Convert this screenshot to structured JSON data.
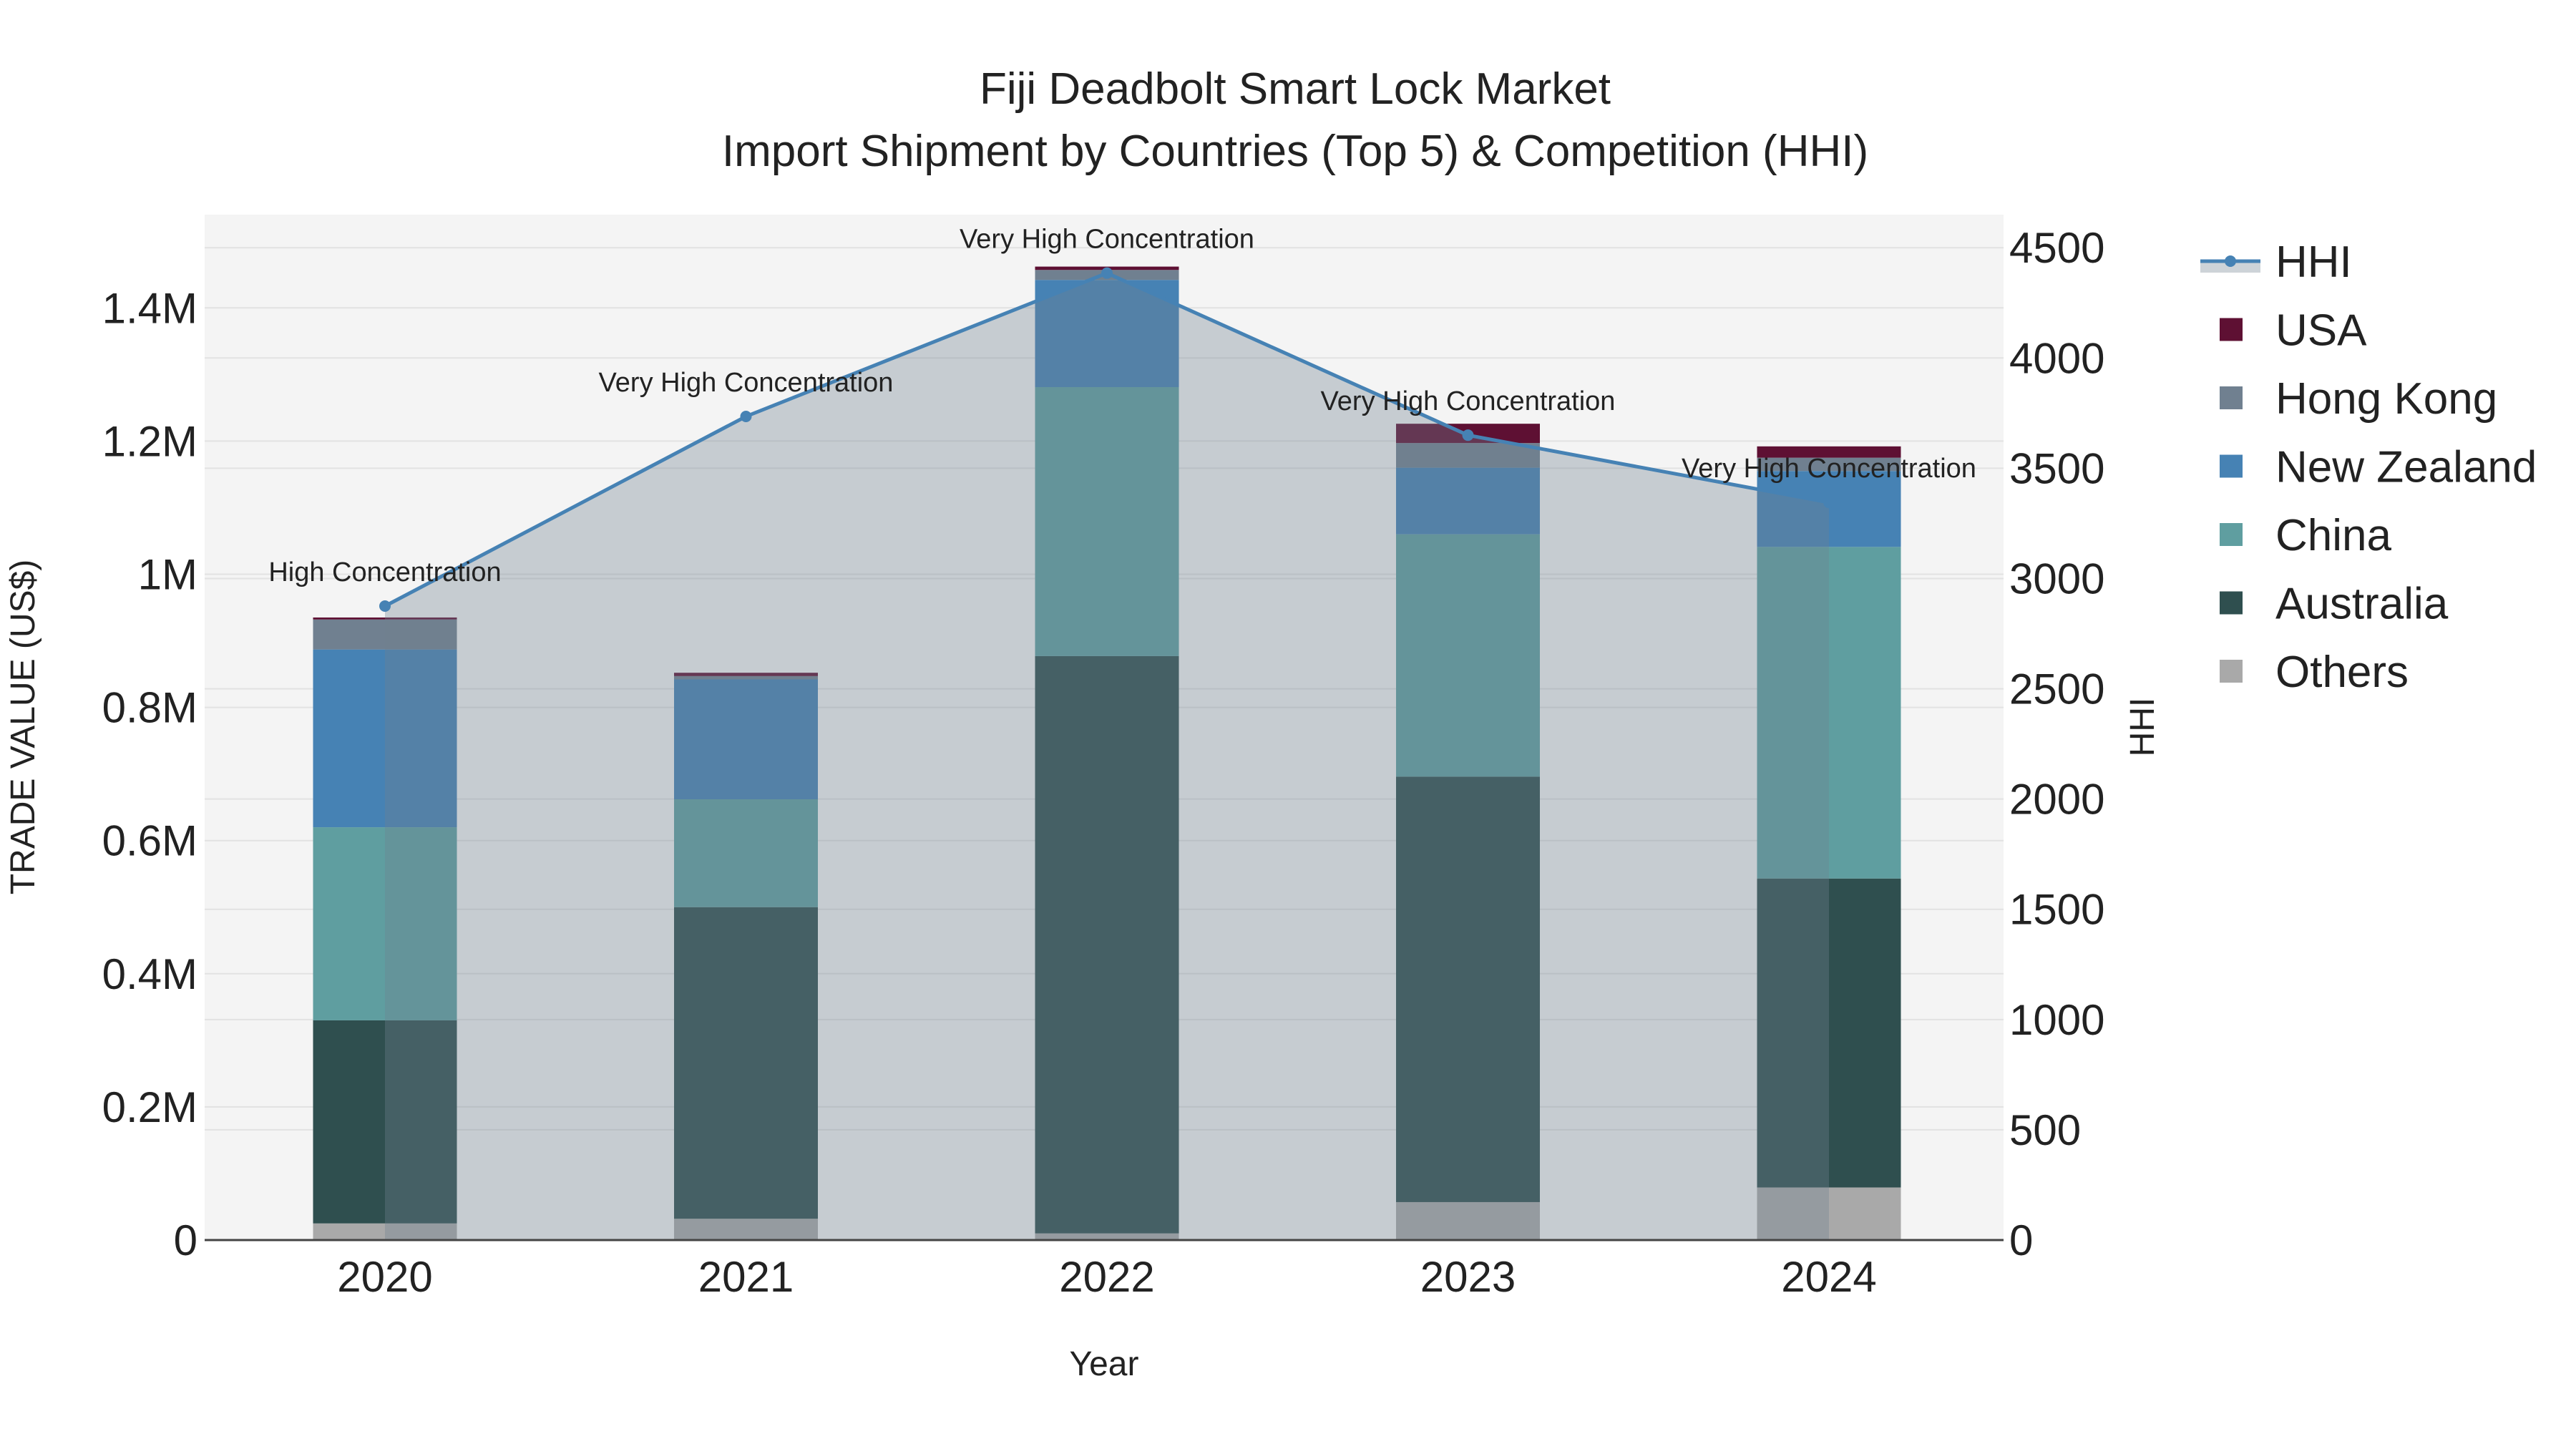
{
  "chart_data": {
    "type": "bar",
    "title": "Fiji Deadbolt Smart Lock Market",
    "subtitle": "Import Shipment by Countries (Top 5) & Competition (HHI)",
    "xlabel": "Year",
    "ylabel": "TRADE VALUE (US$)",
    "y2label": "HHI",
    "categories": [
      "2020",
      "2021",
      "2022",
      "2023",
      "2024"
    ],
    "stacked": true,
    "ylim": [
      0,
      1540000
    ],
    "y2lim": [
      0,
      4650
    ],
    "yticks": [
      0,
      200000,
      400000,
      600000,
      800000,
      1000000,
      1200000,
      1400000
    ],
    "ytick_labels": [
      "0",
      "0.2M",
      "0.4M",
      "0.6M",
      "0.8M",
      "1M",
      "1.2M",
      "1.4M"
    ],
    "y2ticks": [
      0,
      500,
      1000,
      1500,
      2000,
      2500,
      3000,
      3500,
      4000,
      4500
    ],
    "y2tick_labels": [
      "0",
      "500",
      "1000",
      "1500",
      "2000",
      "2500",
      "3000",
      "3500",
      "4000",
      "4500"
    ],
    "series": [
      {
        "name": "Others",
        "color": "#a9a9a9",
        "values": [
          25000,
          32000,
          10000,
          57000,
          79000
        ]
      },
      {
        "name": "Australia",
        "color": "#2f4f4f",
        "values": [
          305000,
          468000,
          867000,
          639000,
          464000
        ]
      },
      {
        "name": "China",
        "color": "#5f9ea0",
        "values": [
          290000,
          162000,
          404000,
          364000,
          498000
        ]
      },
      {
        "name": "New Zealand",
        "color": "#4682b4",
        "values": [
          267000,
          180000,
          161000,
          100000,
          114000
        ]
      },
      {
        "name": "Hong Kong",
        "color": "#708090",
        "values": [
          45000,
          5000,
          15000,
          37000,
          20000
        ]
      },
      {
        "name": "USA",
        "color": "#5e1033",
        "values": [
          3000,
          5000,
          5000,
          29000,
          17000
        ]
      }
    ],
    "line": {
      "name": "HHI",
      "axis": "right",
      "color": "#4682b4",
      "values": [
        2875,
        3735,
        4385,
        3650,
        3345
      ],
      "annotations": [
        "High Concentration",
        "Very High Concentration",
        "Very High Concentration",
        "Very High Concentration",
        "Very High Concentration"
      ]
    },
    "legend_order": [
      "HHI",
      "USA",
      "Hong Kong",
      "New Zealand",
      "China",
      "Australia",
      "Others"
    ],
    "legend_position": "right",
    "grid": true
  }
}
